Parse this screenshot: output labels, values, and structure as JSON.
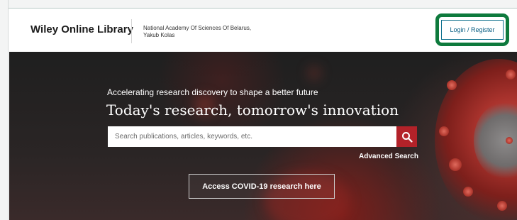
{
  "header": {
    "brand": "Wiley Online Library",
    "institution_line1": "National Academy Of Sciences Of Belarus,",
    "institution_line2": "Yakub Kolas",
    "login_label": "Login / Register"
  },
  "hero": {
    "subtitle": "Accelerating research discovery to shape a better future",
    "title": "Today's research, tomorrow's innovation",
    "search_placeholder": "Search publications, articles, keywords, etc.",
    "advanced_search": "Advanced Search",
    "covid_button": "Access COVID-19 research here"
  },
  "colors": {
    "highlight": "#0e7a3d",
    "search_button": "#b32229",
    "login_text": "#0a5f84"
  },
  "icons": {
    "search": "magnifier"
  }
}
